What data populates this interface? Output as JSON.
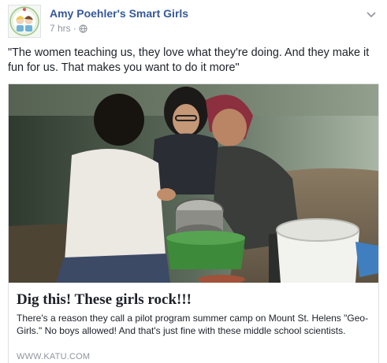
{
  "post": {
    "page_name": "Amy Poehler's Smart Girls",
    "timestamp": "7 hrs",
    "separator": "·",
    "caption": "\"The women teaching us, they love what they're doing. And they make it fun for us. That makes you want to do it more\""
  },
  "link_preview": {
    "title": "Dig this! These girls rock!!!",
    "description": "There's a reason they call a pilot program summer camp on Mount St. Helens \"Geo-Girls.\" No boys allowed! And that's just fine with these middle school scientists.",
    "domain": "WWW.KATU.COM"
  },
  "icons": {
    "audience": "globe-icon",
    "menu": "chevron-down-icon"
  },
  "colors": {
    "page_name": "#365899",
    "text": "#1d2129",
    "meta": "#90949c",
    "border": "#dddfe2"
  }
}
